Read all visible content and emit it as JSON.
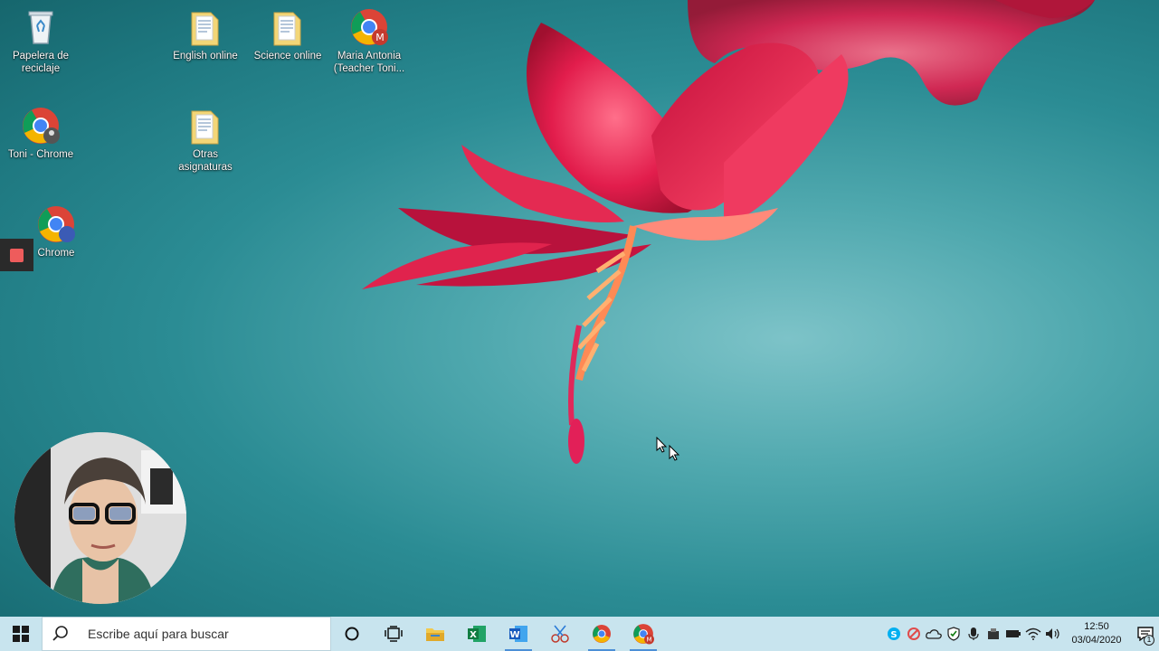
{
  "desktop": {
    "icons": [
      {
        "name": "recycle-bin",
        "label": "Papelera de reciclaje",
        "icon": "recycle-bin-icon"
      },
      {
        "name": "english-online",
        "label": "English online",
        "icon": "folder-icon"
      },
      {
        "name": "science-online",
        "label": "Science online",
        "icon": "folder-icon"
      },
      {
        "name": "maria-antonia",
        "label": "Maria Antonia (Teacher Toni...",
        "icon": "chrome-profile-icon",
        "badge": "M"
      },
      {
        "name": "toni-chrome",
        "label": "Toni - Chrome",
        "icon": "chrome-profile-icon"
      },
      {
        "name": "otras-asignaturas",
        "label": "Otras asignaturas",
        "icon": "folder-icon"
      },
      {
        "name": "chrome-3",
        "label": "Chrome",
        "icon": "chrome-profile-icon"
      }
    ]
  },
  "recorder": {
    "icon": "stop-record-icon"
  },
  "taskbar": {
    "search_placeholder": "Escribe aquí para buscar",
    "apps": [
      {
        "name": "cortana",
        "icon": "cortana-icon"
      },
      {
        "name": "task-view",
        "icon": "task-view-icon"
      },
      {
        "name": "file-explorer",
        "icon": "file-explorer-icon"
      },
      {
        "name": "excel",
        "icon": "excel-icon",
        "letter": "X"
      },
      {
        "name": "word",
        "icon": "word-icon",
        "letter": "W",
        "active": true
      },
      {
        "name": "snipping-tool",
        "icon": "snipping-tool-icon"
      },
      {
        "name": "chrome",
        "icon": "chrome-icon",
        "active": true
      },
      {
        "name": "chrome-profile",
        "icon": "chrome-profile-icon",
        "badge": "M",
        "active": true
      }
    ],
    "tray": [
      "skype-icon",
      "sync-icon",
      "onedrive-icon",
      "defender-icon",
      "microphone-icon",
      "usb-icon",
      "battery-icon",
      "wifi-icon",
      "volume-icon"
    ],
    "time": "12:50",
    "date": "03/04/2020",
    "notification_count": "1"
  },
  "colors": {
    "taskbar": "#c8e4ee",
    "accent": "#4c8fd6",
    "flower": "#e4234e",
    "record": "#ee5c5c"
  }
}
